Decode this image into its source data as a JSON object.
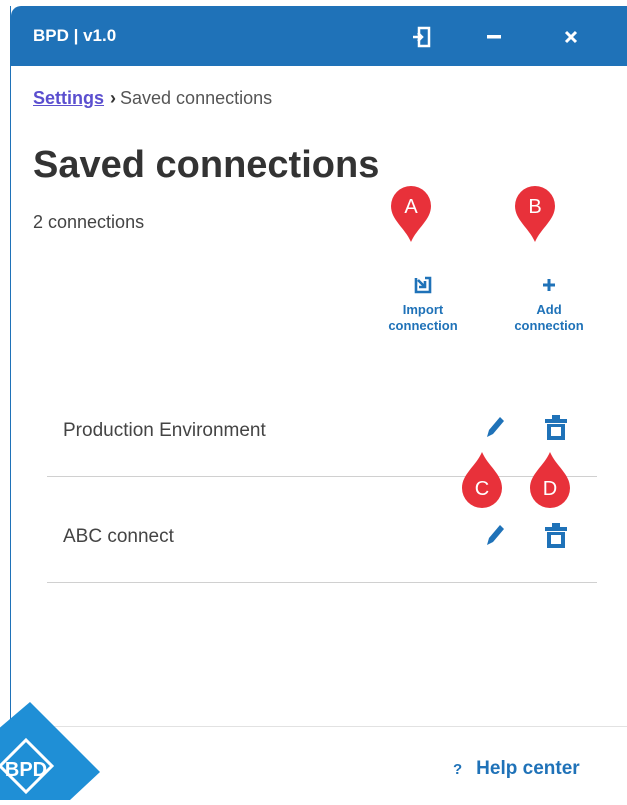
{
  "window": {
    "title": "BPD | v1.0"
  },
  "breadcrumb": {
    "parent": "Settings",
    "current": "Saved connections"
  },
  "page": {
    "title": "Saved connections",
    "count": "2 connections"
  },
  "actions": {
    "import_line1": "Import",
    "import_line2": "connection",
    "add_line1": "Add",
    "add_line2": "connection"
  },
  "connections": [
    {
      "name": "Production Environment"
    },
    {
      "name": "ABC connect"
    }
  ],
  "footer": {
    "help": "Help center",
    "help_icon": "?",
    "logo_text": "BPD"
  },
  "markers": [
    "A",
    "B",
    "C",
    "D"
  ],
  "colors": {
    "brand": "#1f72b8",
    "marker": "#e8313a",
    "link": "#5b4fcf"
  }
}
